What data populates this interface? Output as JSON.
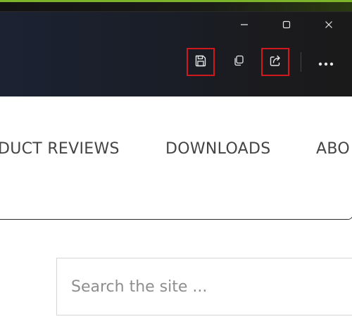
{
  "window": {
    "controls": {
      "minimize_icon": "minimize-icon",
      "maximize_icon": "maximize-icon",
      "close_icon": "close-icon"
    },
    "toolbar": [
      {
        "name": "save-button",
        "icon": "save-icon",
        "highlighted": true
      },
      {
        "name": "copy-button",
        "icon": "copy-icon",
        "highlighted": false
      },
      {
        "name": "share-button",
        "icon": "share-icon",
        "highlighted": true
      },
      {
        "name": "more-options-button",
        "icon": "more-horizontal-icon",
        "highlighted": false
      }
    ],
    "highlight_color": "#d1191d",
    "titlebar_color": "#1c1f29"
  },
  "nav": {
    "items": [
      "DUCT REVIEWS",
      "DOWNLOADS",
      "ABO"
    ]
  },
  "search": {
    "placeholder": "Search the site ..."
  }
}
